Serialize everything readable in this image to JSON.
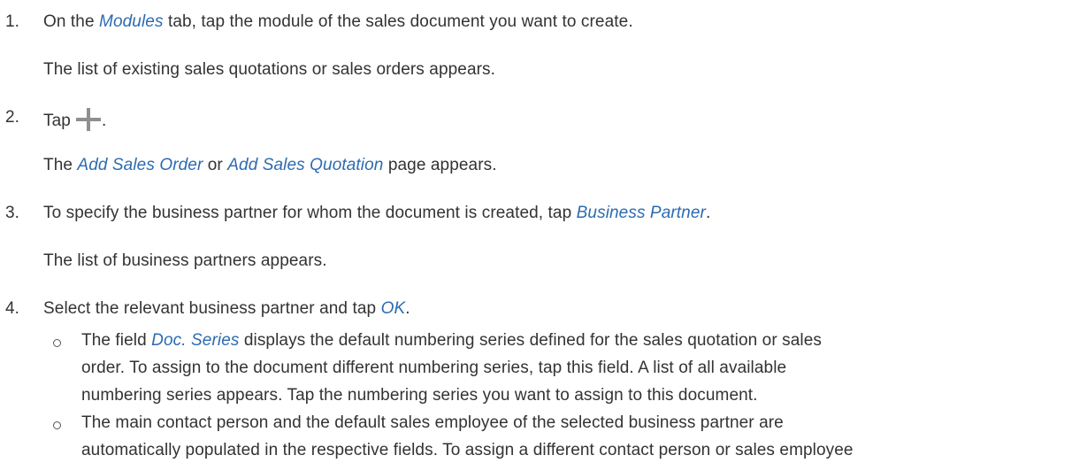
{
  "steps": [
    {
      "number": "1.",
      "pre": "On the ",
      "link": "Modules",
      "post": " tab, tap the module of the sales document you want to create.",
      "result": "The list of existing sales quotations or sales orders appears."
    },
    {
      "number": "2.",
      "pre": "Tap",
      "icon": "plus-icon",
      "post": ".",
      "result_link1": "Add Sales Order",
      "result_mid": " or ",
      "result_link2": "Add Sales Quotation",
      "result_post": " page appears.",
      "result_pre": "The "
    },
    {
      "number": "3.",
      "pre": "To specify the business partner for whom the document is created, tap ",
      "link": "Business Partner",
      "post": ".",
      "result": "The list of business partners appears."
    },
    {
      "number": "4.",
      "pre": "Select the relevant business partner and tap ",
      "link": "OK",
      "post": ".",
      "bullets": [
        {
          "line1_pre": "The field ",
          "line1_link": "Doc. Series",
          "line1_post": " displays the default numbering series defined for the sales quotation or sales",
          "line2": "order. To assign to the document different numbering series, tap this field. A list of all available",
          "line3": "numbering series appears. Tap the numbering series you want to assign to this document."
        },
        {
          "line1": "The main contact person and the default sales employee of the selected business partner are",
          "line2": "automatically populated in the respective fields. To assign a different contact person or sales employee"
        }
      ]
    }
  ],
  "colors": {
    "text": "#333333",
    "link": "#2c6bb0",
    "icon": "#8f8f8f"
  }
}
